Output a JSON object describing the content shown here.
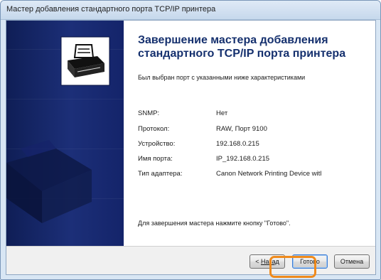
{
  "window": {
    "title": "Мастер добавления стандартного порта TCP/IP принтера"
  },
  "side_panel": {
    "icon": "printer-wizard-icon"
  },
  "page": {
    "heading_line1": "Завершение мастера добавления",
    "heading_line2": "стандартного TCP/IP порта принтера",
    "intro": "Был выбран порт с указанными ниже характеристиками",
    "rows": [
      {
        "label": "SNMP:",
        "value": "Нет"
      },
      {
        "label": "Протокол:",
        "value": "RAW, Порт 9100"
      },
      {
        "label": "Устройство:",
        "value": "192.168.0.215"
      },
      {
        "label": "Имя порта:",
        "value": "IP_192.168.0.215"
      },
      {
        "label": "Тип адаптера:",
        "value": "Canon Network Printing Device witl"
      }
    ],
    "finish_note": "Для завершения мастера нажмите кнопку \"Готово\"."
  },
  "buttons": {
    "back_prefix": "< ",
    "back_label": "Назад",
    "finish_label": "Готово",
    "cancel_label": "Отмена"
  },
  "colors": {
    "side_panel": "#1c2f78",
    "heading": "#15306e",
    "highlight": "#ef8a1c"
  }
}
